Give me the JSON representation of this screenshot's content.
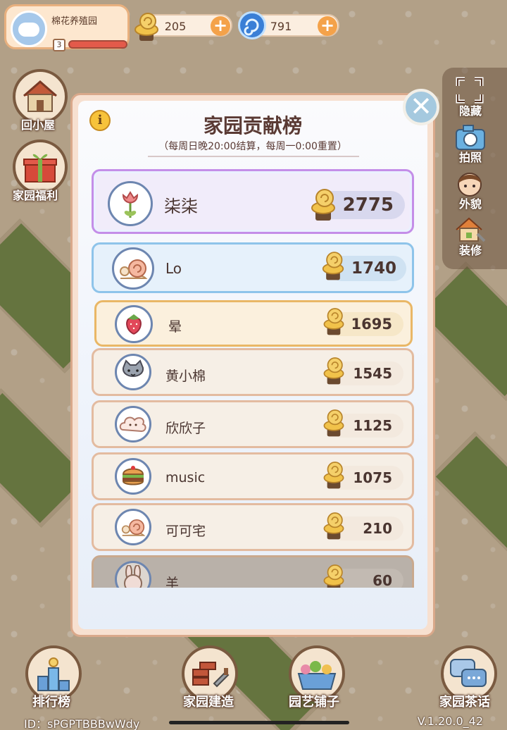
{
  "hud": {
    "garden_name": "棉花养殖园",
    "level": "3",
    "snail_currency": "205",
    "gem_currency": "791",
    "currency_icons": [
      "snail-coin-icon",
      "blue-swirl-icon"
    ]
  },
  "left_menu": {
    "home": "回小屋",
    "welfare": "家园福利"
  },
  "right_menu": {
    "hide": "隐藏",
    "photo": "拍照",
    "appearance": "外貌",
    "decorate": "装修"
  },
  "modal": {
    "title": "家园贡献榜",
    "subtitle": "（每周日晚20:00结算，每周一0:00重置）",
    "close_icon": "close-icon",
    "info_icon": "info-icon",
    "rows": [
      {
        "name": "柒柒",
        "score": "2775",
        "avatar": "tulip-icon",
        "frame": "#c48ee8"
      },
      {
        "name": "Lo",
        "score": "1740",
        "avatar": "snail-icon",
        "frame": "#8ec4ea"
      },
      {
        "name": "晕",
        "score": "1695",
        "avatar": "strawberry-icon",
        "frame": "#e9b766"
      },
      {
        "name": "黄小棉",
        "score": "1545",
        "avatar": "cat-icon",
        "frame": "#e3bba0"
      },
      {
        "name": "欣欣子",
        "score": "1125",
        "avatar": "cloud-face-icon",
        "frame": "#e3bba0"
      },
      {
        "name": "music",
        "score": "1075",
        "avatar": "burger-icon",
        "frame": "#e3bba0"
      },
      {
        "name": "可可宅",
        "score": "210",
        "avatar": "snail-icon",
        "frame": "#e3bba0"
      },
      {
        "name": "羊",
        "score": "60",
        "avatar": "bunny-icon",
        "frame": "#c9a98e"
      }
    ]
  },
  "bottom_menu": {
    "ranking": "排行榜",
    "build": "家园建造",
    "shop": "园艺铺子",
    "teahouse": "家园茶话"
  },
  "footer": {
    "id": "ID：sPGPTBBBwWdy",
    "version": "V.1.20.0_42"
  }
}
